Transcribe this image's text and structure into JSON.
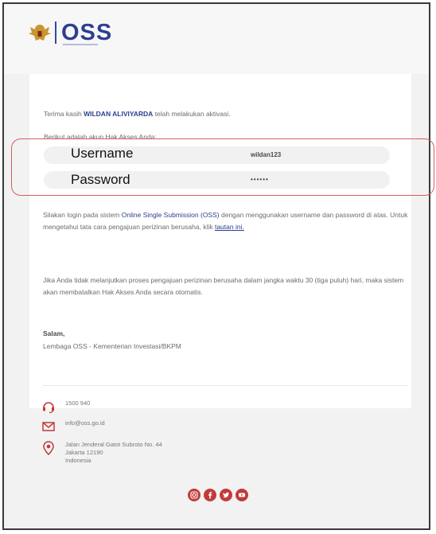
{
  "header": {
    "logo_text": "OSS"
  },
  "email": {
    "greeting_prefix": "Terima kasih",
    "user_name": "WILDAN ALIVIYARDA",
    "greeting_suffix": "telah melakukan aktivasi.",
    "intro": "Berikut adalah akun Hak Akses Anda:",
    "credentials": {
      "username_label": "Username",
      "username_value": "wildan123",
      "password_label": "Password",
      "password_value": "••••••"
    },
    "paragraph1": {
      "part1": "Silakan login pada sistem",
      "link_system": "Online Single Submission (OSS)",
      "part2": "dengan menggunakan username dan password di atas. Untuk mengetahui tata cara pengajuan perizinan berusaha, klik",
      "link_text": "tautan ini."
    },
    "paragraph2": "Jika Anda tidak melanjutkan proses pengajuan perizinan berusaha dalam jangka waktu 30 (tiga puluh) hari, maka sistem akan membatalkan Hak Akses Anda secara otomatis.",
    "salam": "Salam,",
    "organization": "Lembaga OSS - Kementerian Investasi/BKPM"
  },
  "footer": {
    "phone": "1500 940",
    "email": "info@oss.go.id",
    "address_line1": "Jalan Jenderal Gatot Subroto No. 44",
    "address_line2": "Jakarta 12190",
    "address_line3": "Indonesia",
    "social_icons": [
      "instagram-icon",
      "facebook-icon",
      "twitter-icon",
      "youtube-icon"
    ],
    "accent_color": "#c23b3b"
  }
}
